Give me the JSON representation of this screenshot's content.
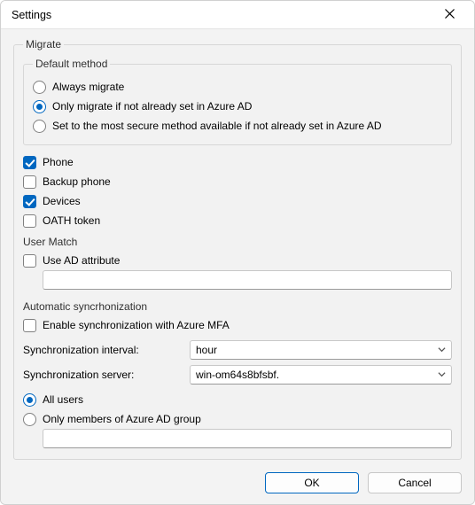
{
  "window": {
    "title": "Settings"
  },
  "migrate": {
    "legend": "Migrate",
    "default_method": {
      "legend": "Default method",
      "options": {
        "always": "Always migrate",
        "if_not_set": "Only migrate if not already set in Azure AD",
        "most_secure": "Set to the most secure method available if not already set in Azure AD"
      },
      "selected": "if_not_set"
    },
    "checks": {
      "phone": {
        "label": "Phone",
        "checked": true
      },
      "backup_phone": {
        "label": "Backup phone",
        "checked": false
      },
      "devices": {
        "label": "Devices",
        "checked": true
      },
      "oath_token": {
        "label": "OATH token",
        "checked": false
      }
    },
    "user_match": {
      "label": "User Match",
      "use_ad_attribute": {
        "label": "Use AD attribute",
        "checked": false
      },
      "attribute_value": ""
    },
    "autosync": {
      "label": "Automatic syncrhonization",
      "enable": {
        "label": "Enable synchronization with Azure MFA",
        "checked": false
      },
      "interval_label": "Synchronization interval:",
      "interval_value": "hour",
      "server_label": "Synchronization server:",
      "server_value": "win-om64s8bfsbf.",
      "scope": {
        "all": "All users",
        "group": "Only members of Azure AD group",
        "selected": "all"
      },
      "group_value": ""
    }
  },
  "footer": {
    "ok": "OK",
    "cancel": "Cancel"
  }
}
